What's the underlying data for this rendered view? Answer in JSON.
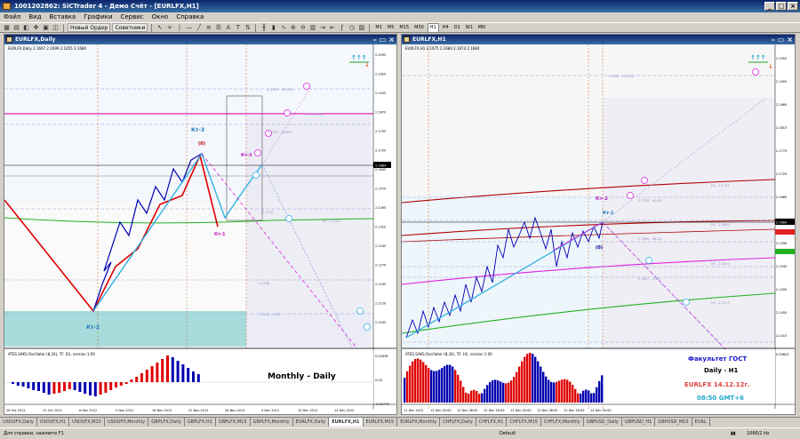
{
  "app": {
    "title": "1001202862: SiCTrader 4 - Демо Счёт - [EURLFX,H1]"
  },
  "menu": [
    "Файл",
    "Вид",
    "Вставка",
    "Графики",
    "Сервис",
    "Окно",
    "Справка"
  ],
  "toolbar": {
    "new_order": "Новый Ордер",
    "advisors": "Советники",
    "timeframes": [
      "M1",
      "M5",
      "M15",
      "M30",
      "H1",
      "H4",
      "D1",
      "W1",
      "MN"
    ],
    "active_tf": "H1"
  },
  "left": {
    "title": "EURLFX,Daily",
    "info": "EURLFX,Daily  2.1667 2.1699 2.1655 2.1684",
    "osc_label": "ATES.SAKS.Oscillator (8,34), TF: D1, version 1.00",
    "osc_ticks": [
      "0.02838",
      "0.00",
      "-0.01779"
    ],
    "price_ticks": [
      "2.2095",
      "2.2020",
      "2.1945",
      "2.1870",
      "2.1795",
      "2.1720",
      "2.1645",
      "2.1570",
      "2.1495",
      "2.1420",
      "2.1345",
      "2.1270",
      "2.1195",
      "2.1120",
      "2.1045"
    ],
    "current_price": "2.1684",
    "date_ticks": [
      "26 Oct 2012",
      "31 Oct 2012",
      "6 Nov 2012",
      "9 Nov 2012",
      "16 Nov 2012",
      "22 Nov 2012",
      "28 Nov 2012",
      "4 Dec 2012",
      "10 Dec 2012",
      "14 Dec 2012"
    ],
    "labels": {
      "kt3": "Кт-3",
      "kt2": "Кт-2",
      "kt1": "Кт-1",
      "kt3b": "Кт-3",
      "zero": "(0)"
    },
    "levels": [
      "2.1959 - 161.8%",
      "D1 - 2.1679",
      "2.1827 - 61.8%",
      "D1 - 2.1477",
      "2.1518",
      "2.1248",
      "2.1104 - 0.0%"
    ],
    "monthly_daily": "Monthly - Daily"
  },
  "right": {
    "title": "EURLFX,H1",
    "info": "EURLFX,H1  2.1675 2.1684 2.1674 2.1684",
    "osc_label": "ATES.SAKS.Oscillator (8,34), TF: H1, version 1.00",
    "osc_ticks": [
      "0.00603"
    ],
    "price_ticks": [
      "2.1950",
      "2.1905",
      "2.1860",
      "2.1815",
      "2.1770",
      "2.1725",
      "2.1680",
      "2.1635",
      "2.1590",
      "2.1545",
      "2.1500",
      "2.1455",
      "2.1410"
    ],
    "current_price": "2.1684",
    "date_ticks": [
      "11 Dec 2012",
      "12 Dec 00:00",
      "12 Dec 08:00",
      "12 Dec 16:00",
      "13 Dec 00:00",
      "13 Dec 08:00",
      "13 Dec 16:00",
      "14 Dec 00:00"
    ],
    "labels": {
      "kt2": "Кт-2",
      "kt1": "Кт-1",
      "zero": "(0)"
    },
    "levels": [
      "2.1906 - 161.8%",
      "H1 - 2.1747",
      "2.1735 - 61.8%",
      "H1 - 2.1682",
      "2.1660 - 38.2%",
      "H1 - 2.1631",
      "2.1617 - 0.0%",
      "H1 - 2.1573"
    ],
    "footer": {
      "school": "Факультет ГОСТ",
      "tf": "Daily - H1",
      "symbol_date": "EURLFX 14.12.12г.",
      "time": "08:50  GMT+6"
    }
  },
  "tabs": [
    "USDUFX,Daily",
    "USDUFX,H1",
    "USDUFX,M15",
    "USDUFX,Monthly",
    "GBPLFX,Daily",
    "GBPLFX,H1",
    "GBPLFX,M15",
    "GBPLFX,Monthly",
    "EURLFX,Daily",
    "EURLFX,H1",
    "EURLFX,M15",
    "EURLFX,Monthly",
    "CHFLFX,Daily",
    "CHFLFX,H1",
    "CHFLFX,M15",
    "CHFLFX,Monthly",
    "GBPUSD_Daily",
    "GBPUSD_H1",
    "GBPUSD_M15",
    "EURL"
  ],
  "active_tab": "EURLFX,H1",
  "status": {
    "help": "Для справки, нажмите F1",
    "profile": "Default",
    "traffic": "1066/2 kb"
  },
  "colors": {
    "bull": "#0000b0",
    "bear": "#e00000",
    "fib": "#e020e0",
    "pivot_green": "#20b020",
    "pivot_darkred": "#b00000",
    "band_cyan": "#a8dcdc",
    "ray_blue": "#30b0e0"
  }
}
